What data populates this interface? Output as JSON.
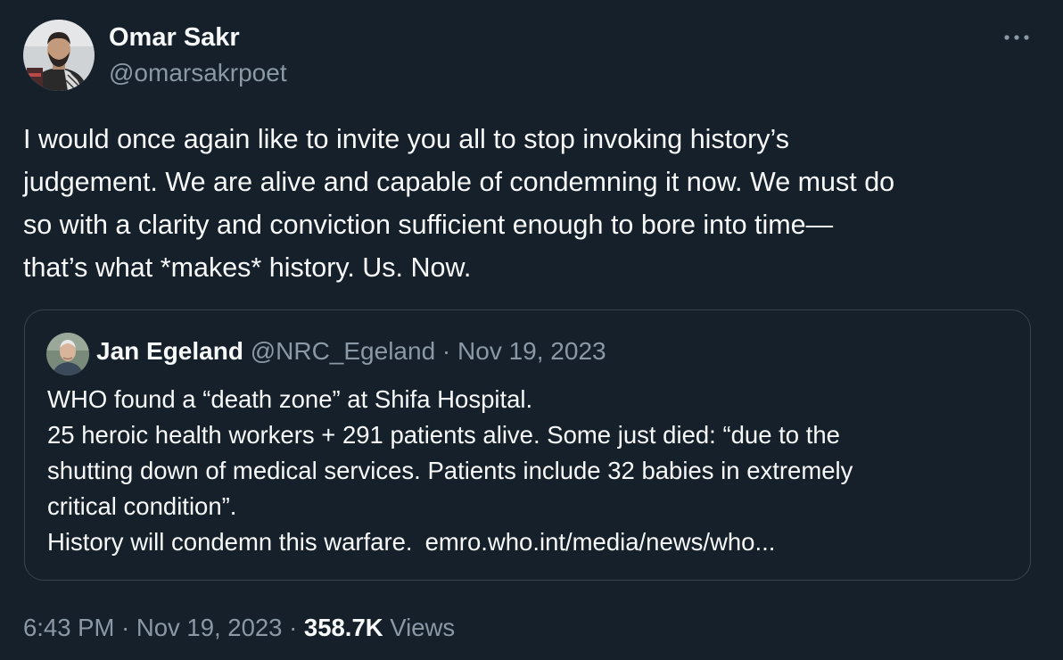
{
  "author": {
    "name": "Omar Sakr",
    "handle": "@omarsakrpoet"
  },
  "tweet": {
    "lines": [
      "I would once again like to invite you all to stop invoking history’s",
      "judgement. We are alive and capable of condemning it now. We must do",
      "so with a clarity and conviction sufficient enough to bore into time—",
      "that’s what *makes* history. Us. Now."
    ]
  },
  "more_icon": "ellipsis-horizontal-icon",
  "quote": {
    "name": "Jan Egeland",
    "handle": "@NRC_Egeland",
    "separator": "·",
    "date": "Nov 19, 2023",
    "lines": [
      "WHO found a “death zone” at Shifa Hospital.",
      "25 heroic health workers + 291 patients alive. Some just died: “due to the",
      "shutting down of medical services. Patients include 32 babies in extremely",
      "critical condition”.",
      "History will condemn this warfare."
    ],
    "link": "emro.who.int/media/news/who..."
  },
  "meta": {
    "time": "6:43 PM",
    "sep1": "·",
    "date": "Nov 19, 2023",
    "sep2": "·",
    "views_count": "358.7K",
    "views_label": "Views"
  },
  "colors": {
    "background": "#15202b",
    "primary_text": "#f7f9f9",
    "secondary_text": "#8b98a5",
    "border": "#38444d"
  }
}
